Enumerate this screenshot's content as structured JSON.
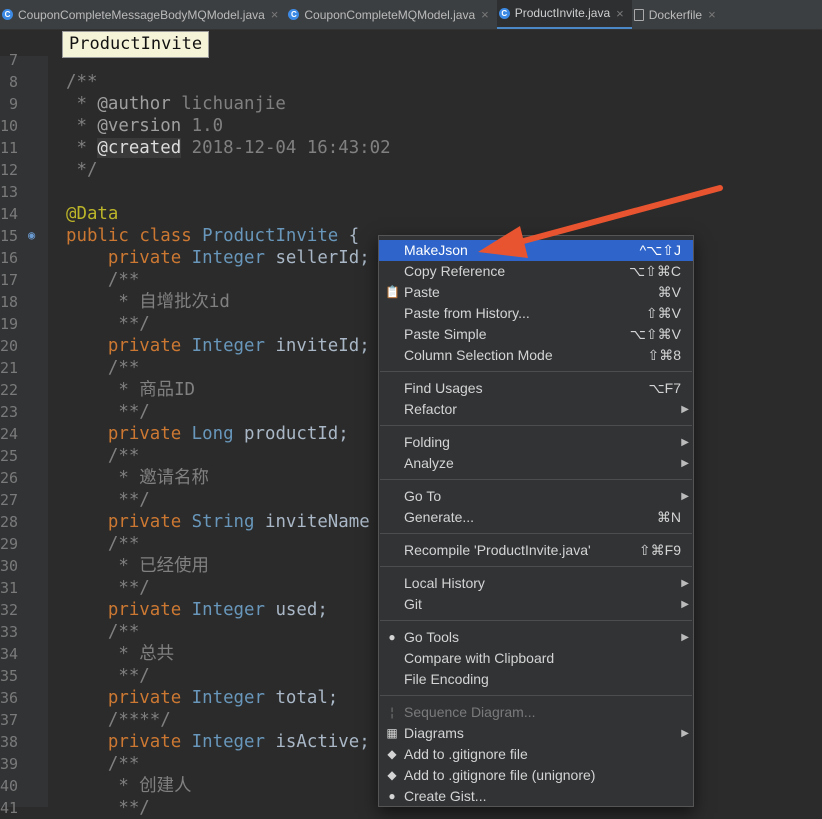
{
  "tabs": [
    {
      "label": "CouponCompleteMessageBodyMQModel.java",
      "icon": "java-class-icon"
    },
    {
      "label": "CouponCompleteMQModel.java",
      "icon": "java-class-icon"
    },
    {
      "label": "ProductInvite.java",
      "icon": "java-class-icon",
      "active": true
    },
    {
      "label": "Dockerfile",
      "icon": "file-icon"
    }
  ],
  "tab_close_glyph": "×",
  "tab_icon_letter": "C",
  "breadcrumb": "ProductInvite",
  "code_lines": [
    {
      "n": "7",
      "text": ""
    },
    {
      "n": "8",
      "text": "/**"
    },
    {
      "n": "9",
      "text": " * @author lichuanjie"
    },
    {
      "n": "10",
      "text": " * @version 1.0"
    },
    {
      "n": "11",
      "text": " * @created 2018-12-04 16:43:02"
    },
    {
      "n": "12",
      "text": " */"
    },
    {
      "n": "13",
      "text": ""
    },
    {
      "n": "14",
      "text": "@Data"
    },
    {
      "n": "15",
      "text": "public class ProductInvite {"
    },
    {
      "n": "16",
      "text": "    private Integer sellerId;"
    },
    {
      "n": "17",
      "text": "    /**"
    },
    {
      "n": "18",
      "text": "     * 自增批次id"
    },
    {
      "n": "19",
      "text": "     **/"
    },
    {
      "n": "20",
      "text": "    private Integer inviteId;"
    },
    {
      "n": "21",
      "text": "    /**"
    },
    {
      "n": "22",
      "text": "     * 商品ID"
    },
    {
      "n": "23",
      "text": "     **/"
    },
    {
      "n": "24",
      "text": "    private Long productId;"
    },
    {
      "n": "25",
      "text": "    /**"
    },
    {
      "n": "26",
      "text": "     * 邀请名称"
    },
    {
      "n": "27",
      "text": "     **/"
    },
    {
      "n": "28",
      "text": "    private String inviteName"
    },
    {
      "n": "29",
      "text": "    /**"
    },
    {
      "n": "30",
      "text": "     * 已经使用"
    },
    {
      "n": "31",
      "text": "     **/"
    },
    {
      "n": "32",
      "text": "    private Integer used;"
    },
    {
      "n": "33",
      "text": "    /**"
    },
    {
      "n": "34",
      "text": "     * 总共"
    },
    {
      "n": "35",
      "text": "     **/"
    },
    {
      "n": "36",
      "text": "    private Integer total;"
    },
    {
      "n": "37",
      "text": "    /****/"
    },
    {
      "n": "38",
      "text": "    private Integer isActive;"
    },
    {
      "n": "39",
      "text": "    /**"
    },
    {
      "n": "40",
      "text": "     * 创建人"
    },
    {
      "n": "41",
      "text": "     **/"
    }
  ],
  "menu": {
    "items": [
      {
        "label": "MakeJson",
        "shortcut": "^⌥⇧J",
        "selected": true
      },
      {
        "label": "Copy Reference",
        "shortcut": "⌥⇧⌘C"
      },
      {
        "label": "Paste",
        "shortcut": "⌘V",
        "icon": "paste-icon"
      },
      {
        "label": "Paste from History...",
        "shortcut": "⇧⌘V"
      },
      {
        "label": "Paste Simple",
        "shortcut": "⌥⇧⌘V"
      },
      {
        "label": "Column Selection Mode",
        "shortcut": "⇧⌘8"
      },
      {
        "sep": true
      },
      {
        "label": "Find Usages",
        "shortcut": "⌥F7"
      },
      {
        "label": "Refactor",
        "submenu": true
      },
      {
        "sep": true
      },
      {
        "label": "Folding",
        "submenu": true
      },
      {
        "label": "Analyze",
        "submenu": true
      },
      {
        "sep": true
      },
      {
        "label": "Go To",
        "submenu": true
      },
      {
        "label": "Generate...",
        "shortcut": "⌘N"
      },
      {
        "sep": true
      },
      {
        "label": "Recompile 'ProductInvite.java'",
        "shortcut": "⇧⌘F9"
      },
      {
        "sep": true
      },
      {
        "label": "Local History",
        "submenu": true
      },
      {
        "label": "Git",
        "submenu": true
      },
      {
        "sep": true
      },
      {
        "label": "Go Tools",
        "submenu": true,
        "icon": "gopher-icon"
      },
      {
        "label": "Compare with Clipboard"
      },
      {
        "label": "File Encoding"
      },
      {
        "sep": true
      },
      {
        "label": "Sequence Diagram...",
        "disabled": true,
        "icon": "sequence-icon"
      },
      {
        "label": "Diagrams",
        "submenu": true,
        "icon": "diagram-icon"
      },
      {
        "label": "Add to .gitignore file",
        "icon": "gitignore-icon"
      },
      {
        "label": "Add to .gitignore file (unignore)",
        "icon": "gitignore-icon"
      },
      {
        "label": "Create Gist...",
        "icon": "github-icon"
      }
    ],
    "submenu_glyph": "▶"
  },
  "colors": {
    "editor_bg": "#2b2b2b",
    "keyword": "#cc7832",
    "type": "#6897bb",
    "comment": "#808080",
    "annotation": "#bbb529",
    "menu_selected": "#2f65ca",
    "arrow": "#e8542f"
  }
}
